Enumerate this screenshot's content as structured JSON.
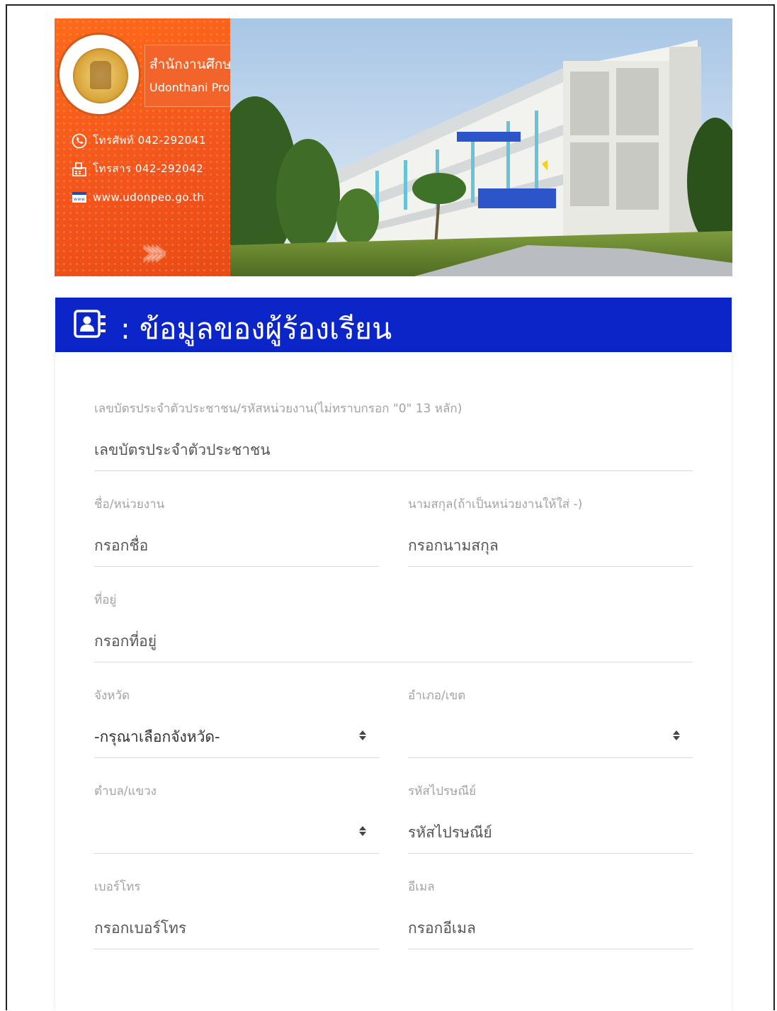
{
  "banner": {
    "title_th": "สำนักงานศึกษาธิการจังหวัดอุดรธานี",
    "title_en": "Udonthani Provincial Education Office",
    "phone": "โทรศัพท์ 042-292041",
    "fax": "โทรสาร 042-292042",
    "website": "www.udonpeo.go.th"
  },
  "heading": {
    "title": ": ข้อมูลของผู้ร้องเรียน"
  },
  "form": {
    "id_number": {
      "label": "เลขบัตรประจำตัวประชาชน/รหัสหน่วยงาน(ไม่ทราบกรอก \"0\" 13 หลัก)",
      "placeholder": "เลขบัตรประจำตัวประชาชน"
    },
    "first_name": {
      "label": "ชื่อ/หน่วยงาน",
      "placeholder": "กรอกชื่อ"
    },
    "last_name": {
      "label": "นามสกุล(ถ้าเป็นหน่วยงานให้ใส่ -)",
      "placeholder": "กรอกนามสกุล"
    },
    "address": {
      "label": "ที่อยู่",
      "placeholder": "กรอกที่อยู่"
    },
    "province": {
      "label": "จังหวัด",
      "selected": "-กรุณาเลือกจังหวัด-"
    },
    "district": {
      "label": "อำเภอ/เขต",
      "selected": ""
    },
    "subdistrict": {
      "label": "ตำบล/แขวง",
      "selected": ""
    },
    "postcode": {
      "label": "รหัสไปรษณีย์",
      "placeholder": "รหัสไปรษณีย์"
    },
    "phone": {
      "label": "เบอร์โทร",
      "placeholder": "กรอกเบอร์โทร"
    },
    "email": {
      "label": "อีเมล",
      "placeholder": "กรอกอีเมล"
    }
  },
  "colors": {
    "heading_bg": "#0b25c8",
    "banner_orange": "#f2541b",
    "label_gray": "#a3a3a3",
    "underline": "#d9d9d9"
  },
  "icons": [
    "contact-card-icon",
    "phone-icon",
    "fax-icon",
    "website-icon",
    "sort-arrows-icon"
  ]
}
